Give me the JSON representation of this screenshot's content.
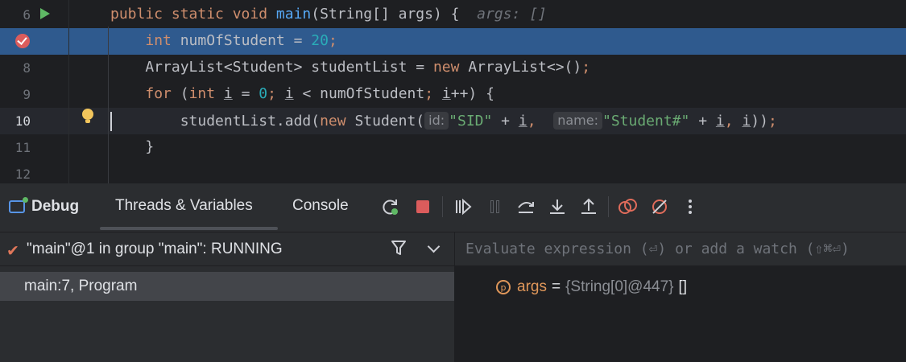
{
  "editor": {
    "lines": [
      {
        "number": "6",
        "tokens": [
          {
            "t": "public static void ",
            "c": "kw"
          },
          {
            "t": "main",
            "c": "fn"
          },
          {
            "t": "(String[] args) {  ",
            "c": ""
          },
          {
            "t": "args: []",
            "c": "hint-inline"
          }
        ]
      },
      {
        "number": "",
        "tokens": [
          {
            "t": "    ",
            "c": ""
          },
          {
            "t": "int ",
            "c": "kw"
          },
          {
            "t": "numOfStudent = ",
            "c": ""
          },
          {
            "t": "20",
            "c": "num"
          },
          {
            "t": ";",
            "c": "kw"
          }
        ]
      },
      {
        "number": "8",
        "tokens": [
          {
            "t": "    ArrayList<Student> studentList = ",
            "c": ""
          },
          {
            "t": "new ",
            "c": "kw"
          },
          {
            "t": "ArrayList<>()",
            "c": ""
          },
          {
            "t": ";",
            "c": "kw"
          }
        ]
      },
      {
        "number": "9",
        "tokens": [
          {
            "t": "    ",
            "c": ""
          },
          {
            "t": "for ",
            "c": "kw"
          },
          {
            "t": "(",
            "c": ""
          },
          {
            "t": "int ",
            "c": "kw"
          },
          {
            "t": "i",
            "c": "under"
          },
          {
            "t": " = ",
            "c": ""
          },
          {
            "t": "0",
            "c": "num"
          },
          {
            "t": "; ",
            "c": "kw"
          },
          {
            "t": "i",
            "c": "under"
          },
          {
            "t": " < numOfStudent",
            "c": ""
          },
          {
            "t": "; ",
            "c": "kw"
          },
          {
            "t": "i",
            "c": "under"
          },
          {
            "t": "++) {",
            "c": ""
          }
        ]
      },
      {
        "number": "10",
        "tokens": [
          {
            "t": "        studentList.add(",
            "c": ""
          },
          {
            "t": "new ",
            "c": "kw"
          },
          {
            "t": "Student(",
            "c": ""
          },
          {
            "t": "id:",
            "c": "pill"
          },
          {
            "t": "\"SID\"",
            "c": "str"
          },
          {
            "t": " + ",
            "c": ""
          },
          {
            "t": "i",
            "c": "under"
          },
          {
            "t": ",  ",
            "c": "kw"
          },
          {
            "t": "name:",
            "c": "pill"
          },
          {
            "t": "\"Student#\"",
            "c": "str"
          },
          {
            "t": " + ",
            "c": ""
          },
          {
            "t": "i",
            "c": "under"
          },
          {
            "t": ", ",
            "c": "kw"
          },
          {
            "t": "i",
            "c": "under"
          },
          {
            "t": "))",
            "c": ""
          },
          {
            "t": ";",
            "c": "kw"
          }
        ]
      },
      {
        "number": "11",
        "tokens": [
          {
            "t": "    }",
            "c": ""
          }
        ]
      },
      {
        "number": "12",
        "tokens": []
      }
    ]
  },
  "toolwindow": {
    "title": "Debug",
    "tabs": [
      "Threads & Variables",
      "Console"
    ],
    "toolbar_icons": [
      "rerun-icon",
      "stop-icon",
      "resume-icon",
      "pause-icon",
      "step-over-icon",
      "step-into-icon",
      "step-out-icon",
      "view-breakpoints-icon",
      "mute-breakpoints-icon",
      "more-options-icon"
    ]
  },
  "threads": {
    "selected_thread": "\"main\"@1 in group \"main\": RUNNING",
    "frames": [
      "main:7, Program"
    ]
  },
  "variables": {
    "evaluate_placeholder": "Evaluate expression (⏎) or add a watch (⇧⌘⏎)",
    "items": [
      {
        "icon": "p",
        "name": "args",
        "eq": "=",
        "type": "{String[0]@447}",
        "value": "[]"
      }
    ]
  },
  "colors": {
    "editor_bg": "#1e1f22",
    "breakpoint_line": "#2f5a8e",
    "keyword": "#cf8e6d",
    "function": "#56a8f5",
    "number": "#2aacb8",
    "string": "#6aab73",
    "breakpoint": "#db5c5c",
    "run": "#5fb865"
  }
}
